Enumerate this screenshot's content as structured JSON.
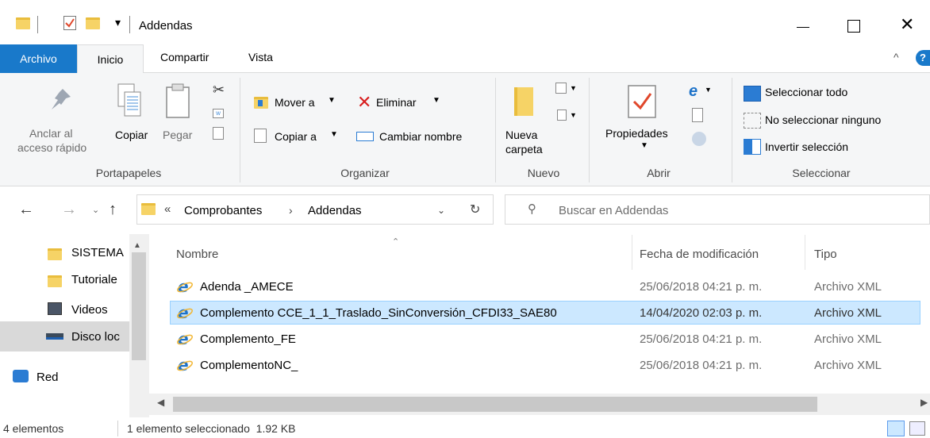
{
  "window": {
    "title": "Addendas",
    "controls": [
      "minimize",
      "maximize",
      "close"
    ]
  },
  "ribbon_tabs": [
    "Archivo",
    "Inicio",
    "Compartir",
    "Vista"
  ],
  "ribbon": {
    "portapapeles": {
      "label": "Portapapeles",
      "anclar_line1": "Anclar al",
      "anclar_line2": "acceso rápido",
      "copiar": "Copiar",
      "pegar": "Pegar"
    },
    "organizar": {
      "label": "Organizar",
      "mover": "Mover a",
      "copiar_a": "Copiar a",
      "eliminar": "Eliminar",
      "cambiar_nombre": "Cambiar nombre"
    },
    "nuevo": {
      "label": "Nuevo",
      "nueva_line1": "Nueva",
      "nueva_line2": "carpeta"
    },
    "abrir": {
      "label": "Abrir",
      "propiedades": "Propiedades"
    },
    "seleccionar": {
      "label": "Seleccionar",
      "todo": "Seleccionar todo",
      "ninguno": "No seleccionar ninguno",
      "invertir": "Invertir selección"
    }
  },
  "address": {
    "prefix": "«",
    "crumb1": "Comprobantes",
    "crumb2": "Addendas",
    "search_placeholder": "Buscar en Addendas"
  },
  "nav": {
    "items": [
      "SISTEMA",
      "Tutoriale",
      "Videos",
      "Disco loc",
      "Red"
    ]
  },
  "columns": {
    "nombre": "Nombre",
    "fecha": "Fecha de modificación",
    "tipo": "Tipo"
  },
  "files": [
    {
      "name": "Adenda _AMECE",
      "date": "25/06/2018 04:21 p. m.",
      "type": "Archivo XML"
    },
    {
      "name": "Complemento CCE_1_1_Traslado_SinConversión_CFDI33_SAE80",
      "date": "14/04/2020 02:03 p. m.",
      "type": "Archivo XML"
    },
    {
      "name": "Complemento_FE",
      "date": "25/06/2018 04:21 p. m.",
      "type": "Archivo XML"
    },
    {
      "name": "ComplementoNC_",
      "date": "25/06/2018 04:21 p. m.",
      "type": "Archivo XML"
    }
  ],
  "status": {
    "count": "4 elementos",
    "selection": "1 elemento seleccionado  1.92 KB"
  },
  "colors": {
    "accent": "#1979ca",
    "selection": "#cce8ff",
    "ribbon_bg": "#f5f6f7"
  }
}
